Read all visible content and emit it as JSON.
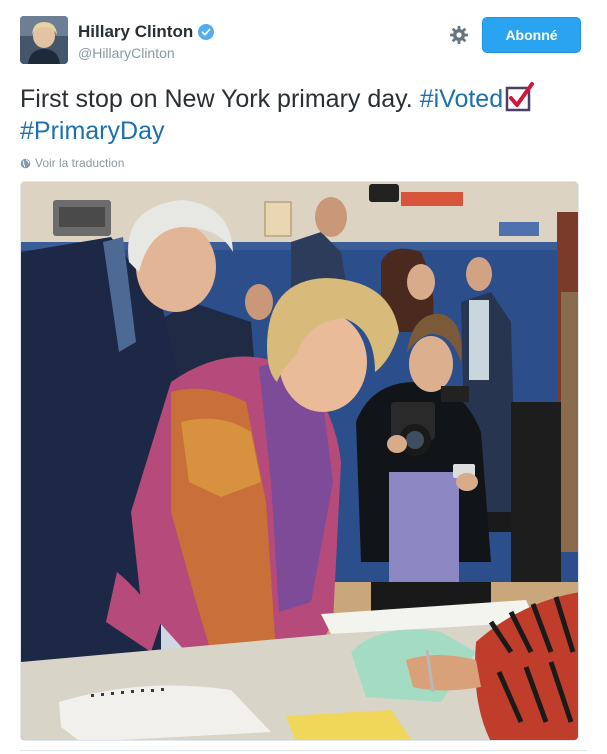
{
  "header": {
    "display_name": "Hillary Clinton",
    "handle": "@HillaryClinton",
    "follow_label": "Abonné",
    "avatar_icon": "user-avatar",
    "verified_icon": "verified-badge-icon",
    "settings_icon": "gear-icon"
  },
  "tweet": {
    "text": "First stop on New York primary day. ",
    "hashtag_1": "#iVoted",
    "emoji": "ballot-box-with-check",
    "hashtag_2": "#PrimaryDay"
  },
  "translate": {
    "label": "Voir la traduction",
    "icon": "globe-icon"
  },
  "media": {
    "type": "photo"
  },
  "colors": {
    "link": "#1b70ad",
    "follow_button": "#2aa4f0",
    "muted": "#8899a6",
    "verified": "#55acee",
    "checkmark": "#d0173a"
  }
}
